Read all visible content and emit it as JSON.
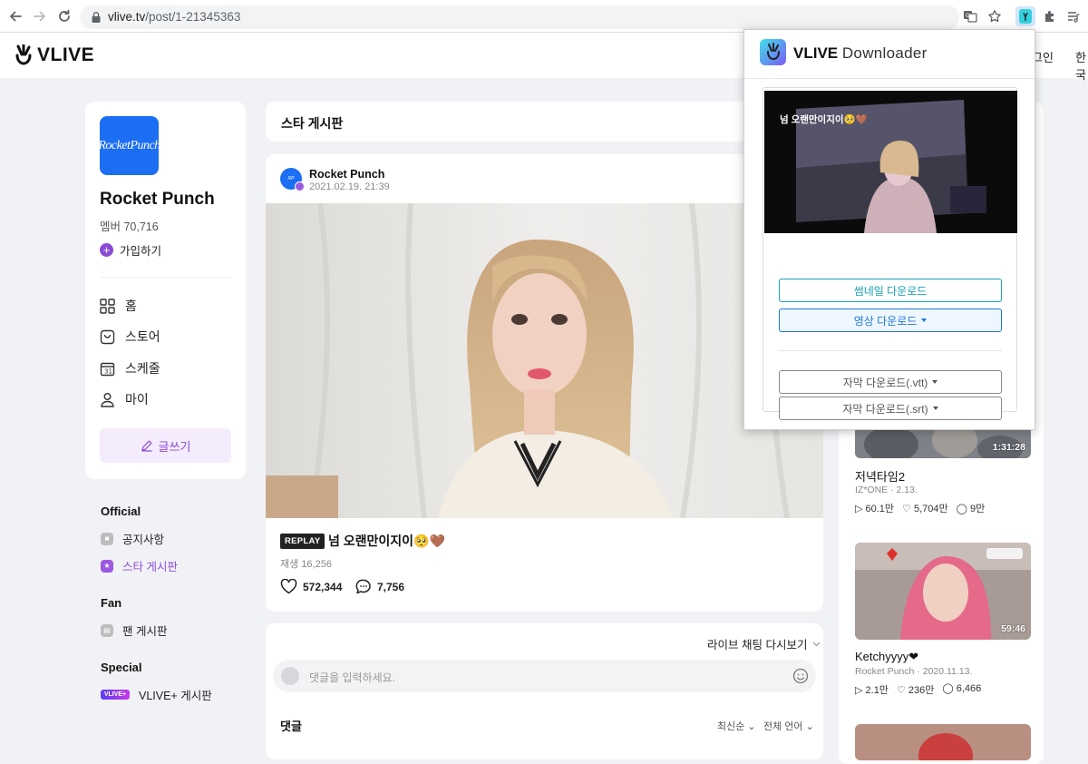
{
  "browser": {
    "url_host": "vlive.tv",
    "url_path": "/post/1-21345363"
  },
  "site": {
    "logo_text": "VLIVE",
    "login": "그인",
    "lang": "한국"
  },
  "channel": {
    "logo_text": "RocketPunch",
    "name": "Rocket Punch",
    "members": "멤버 70,716",
    "join": "가입하기",
    "menu": [
      "홈",
      "스토어",
      "스케줄",
      "마이"
    ],
    "write": "글쓰기"
  },
  "boards": {
    "official_title": "Official",
    "official_items": [
      "공지사항",
      "스타 게시판"
    ],
    "fan_title": "Fan",
    "fan_items": [
      "팬 게시판"
    ],
    "special_title": "Special",
    "special_badge": "VLIVE+",
    "special_items": [
      "VLIVE+ 게시판"
    ]
  },
  "board_header": "스타 게시판",
  "post": {
    "author": "Rocket Punch",
    "date": "2021.02.19. 21:39",
    "badge": "REPLAY",
    "title": "넘 오랜만이지이🥺🤎",
    "plays": "재생 16,256",
    "likes": "572,344",
    "comments": "7,756"
  },
  "comments": {
    "chat_replay": "라이브 채팅 다시보기",
    "placeholder": "댓글을 입력하세요.",
    "label": "댓글",
    "sort_new": "최신순",
    "sort_lang": "전체 언어"
  },
  "right_videos": [
    {
      "title": "저녁타임2",
      "channel": "IZ*ONE",
      "date": "2.13.",
      "duration": "1:31:28",
      "plays": "60.1만",
      "likes": "5,704만",
      "comments": "9만"
    },
    {
      "title": "Ketchyyyy❤",
      "channel": "Rocket Punch",
      "date": "2020.11.13.",
      "duration": "59:46",
      "plays": "2.1만",
      "likes": "236만",
      "comments": "6,466"
    }
  ],
  "extension": {
    "title_bold": "VLIVE",
    "title_rest": "Downloader",
    "thumb_text": "넘 오랜만이지이🥺🤎",
    "btn_thumbnail": "썸네일 다운로드",
    "btn_video": "영상 다운로드",
    "btn_sub_vtt": "자막 다운로드(.vtt)",
    "btn_sub_srt": "자막 다운로드(.srt)"
  },
  "colors": {
    "accent_purple": "#8c4bd6",
    "brand_blue": "#1c6ef2",
    "ext_teal": "#17a2b8"
  }
}
